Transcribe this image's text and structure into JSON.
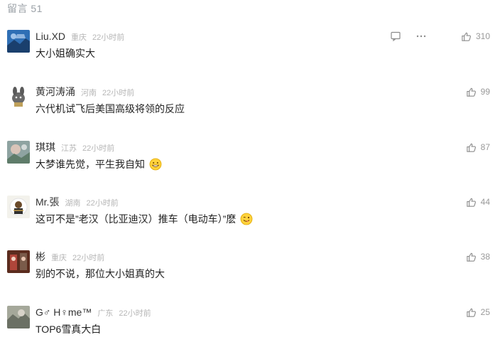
{
  "header": {
    "label": "留言 51"
  },
  "comments": [
    {
      "nick": "Liu.XD",
      "location": "重庆",
      "time": "22小时前",
      "text": "大小姐确实大",
      "likes": "310"
    },
    {
      "nick": "黄河涛涌",
      "location": "河南",
      "time": "22小时前",
      "text": "六代机试飞后美国高级将领的反应",
      "likes": "99"
    },
    {
      "nick": "琪琪",
      "location": "江苏",
      "time": "22小时前",
      "text": "大梦谁先觉，平生我自知",
      "likes": "87",
      "emoji": "grin-emoji"
    },
    {
      "nick": "Mr.張",
      "location": "湖南",
      "time": "22小时前",
      "text": "这可不是”老汉（比亚迪汉）推车（电动车）”麽",
      "likes": "44",
      "emoji": "tongue-emoji"
    },
    {
      "nick": "彬",
      "location": "重庆",
      "time": "22小时前",
      "text": "别的不说，那位大小姐真的大",
      "likes": "38"
    },
    {
      "nick": "G♂ H♀me™",
      "location": "广东",
      "time": "22小时前",
      "text": "TOP6雪真大白",
      "likes": "25"
    }
  ],
  "colors": {
    "muted": "#9aa0a6",
    "text": "#222222"
  },
  "icons": {
    "like": "thumbs-up-icon",
    "reply": "speech-bubble-icon",
    "more": "more-dots-icon"
  }
}
